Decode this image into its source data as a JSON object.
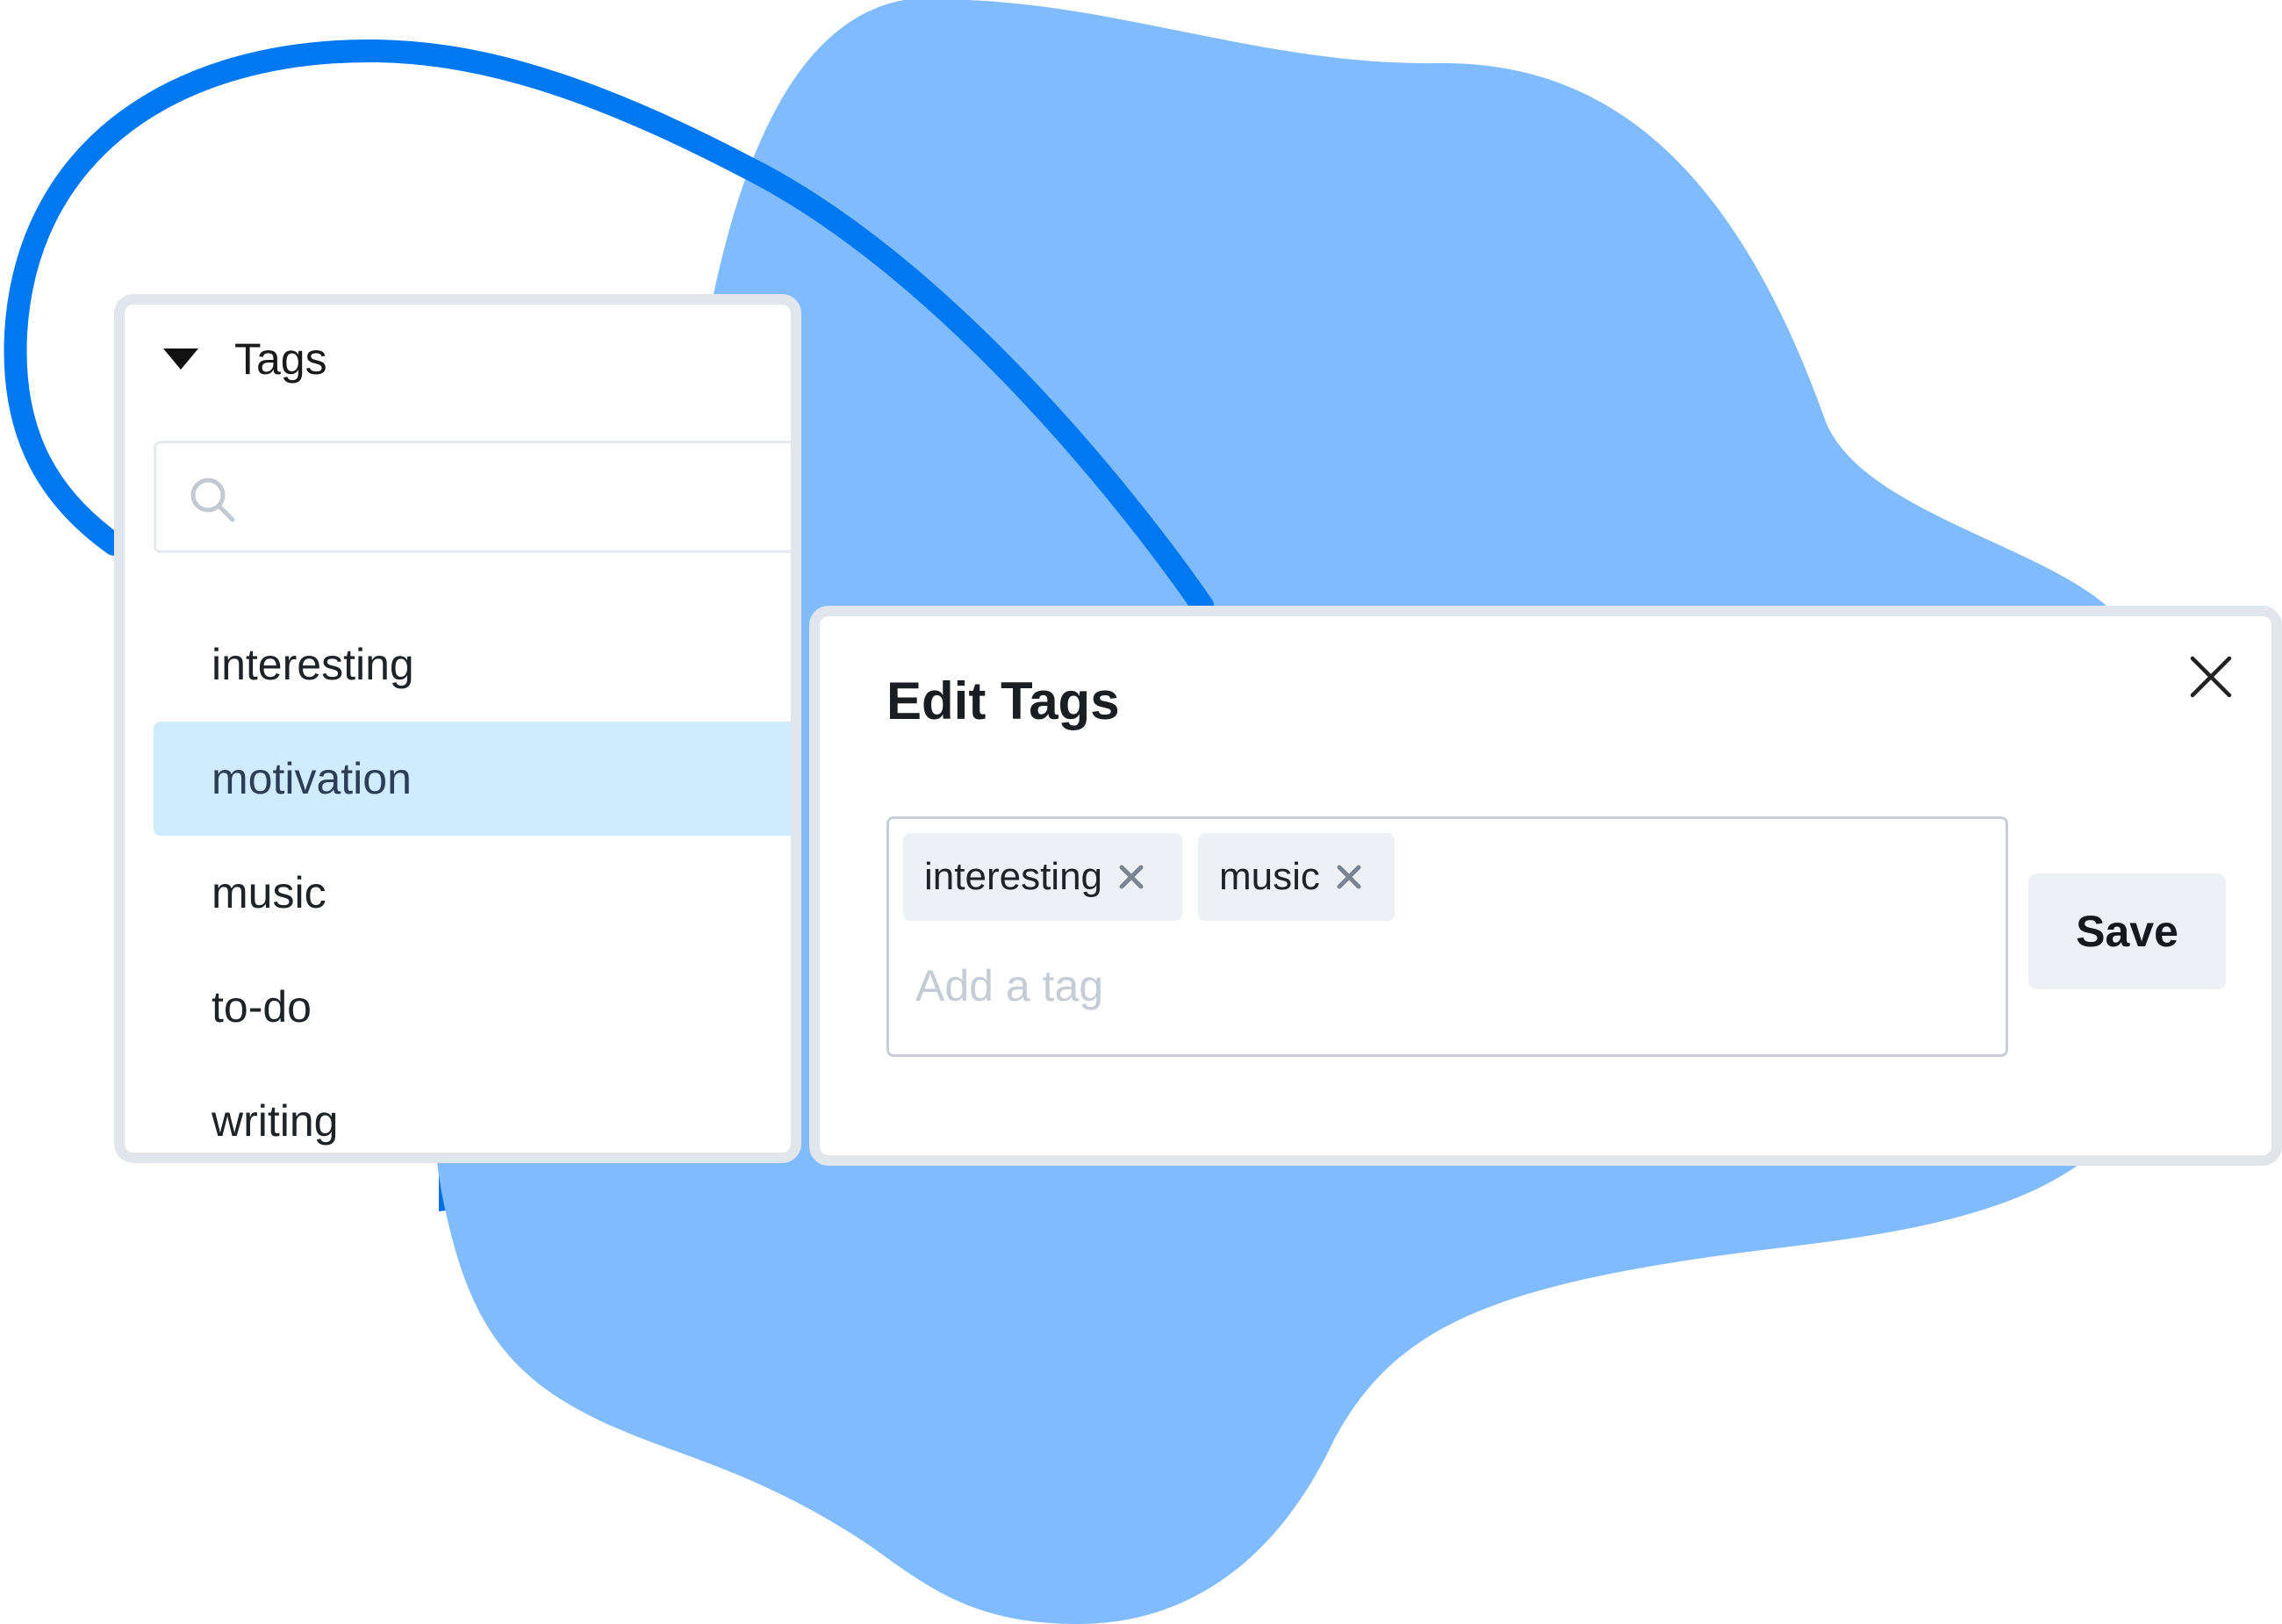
{
  "colors": {
    "blob_light": "#7fbbfd",
    "blob_dark": "#006fe6",
    "accent_stroke": "#0078f0",
    "panel_border": "#e1e5ec",
    "selected_row": "#d1ebfe",
    "chip_background": "#edf0f4",
    "placeholder_text": "#c5ccd6"
  },
  "tags_panel": {
    "title": "Tags",
    "toggle_icon": "caret-down-icon",
    "search": {
      "icon": "search-icon",
      "placeholder": "",
      "value": ""
    },
    "items": [
      {
        "label": "interesting",
        "selected": false
      },
      {
        "label": "motivation",
        "selected": true
      },
      {
        "label": "music",
        "selected": false
      },
      {
        "label": "to-do",
        "selected": false
      },
      {
        "label": "writing",
        "selected": false
      }
    ]
  },
  "edit_dialog": {
    "title": "Edit Tags",
    "close_icon": "close-icon",
    "chips": [
      {
        "label": "interesting",
        "remove_icon": "remove-tag-icon"
      },
      {
        "label": "music",
        "remove_icon": "remove-tag-icon"
      }
    ],
    "input": {
      "placeholder": "Add a tag",
      "value": ""
    },
    "save_label": "Save"
  }
}
